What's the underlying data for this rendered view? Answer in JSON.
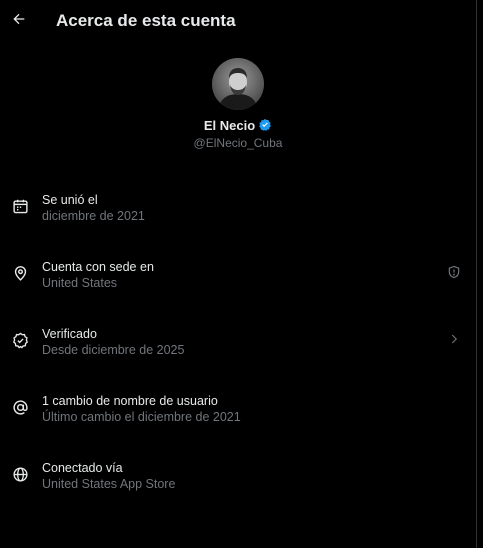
{
  "header": {
    "back_icon": "arrow-left-icon",
    "title": "Acerca de esta cuenta"
  },
  "profile": {
    "display_name": "El Necio",
    "handle": "@ElNecio_Cuba",
    "verified_icon": "verified-badge-icon"
  },
  "rows": [
    {
      "icon": "calendar-icon",
      "label": "Se unió el",
      "value": "diciembre de 2021"
    },
    {
      "icon": "location-pin-icon",
      "label": "Cuenta con sede en",
      "value": "United States",
      "right_icon": "shield-alert-icon"
    },
    {
      "icon": "verified-check-icon",
      "label": "Verificado",
      "value": "Desde diciembre de 2025",
      "right_icon": "chevron-right-icon"
    },
    {
      "icon": "at-sign-icon",
      "label": "1 cambio de nombre de usuario",
      "value": "Último cambio el diciembre de 2021"
    },
    {
      "icon": "globe-icon",
      "label": "Conectado vía",
      "value": "United States App Store"
    }
  ],
  "colors": {
    "background": "#000000",
    "primary_text": "#e7e9ea",
    "secondary_text": "#71767b",
    "verified_blue": "#1d9bf0"
  }
}
